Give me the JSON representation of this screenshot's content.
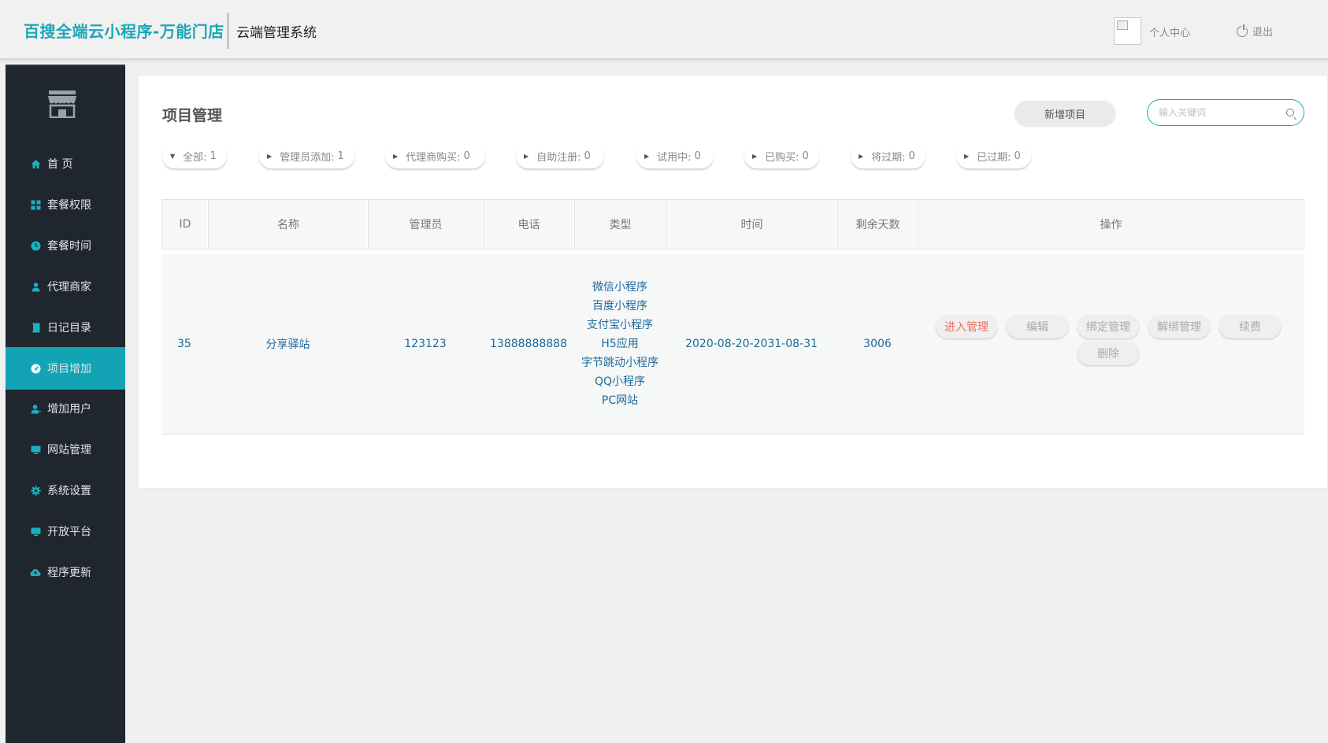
{
  "header": {
    "brand": "百搜全端云小程序-万能门店",
    "subtitle": "云端管理系统",
    "personal": "个人中心",
    "logout": "退出"
  },
  "sidebar": {
    "items": [
      {
        "label": "首 页",
        "icon": "home-icon"
      },
      {
        "label": "套餐权限",
        "icon": "grid-icon"
      },
      {
        "label": "套餐时间",
        "icon": "clock-icon"
      },
      {
        "label": "代理商家",
        "icon": "user-icon"
      },
      {
        "label": "日记目录",
        "icon": "book-icon"
      },
      {
        "label": "项目增加",
        "icon": "dashboard-icon",
        "active": true
      },
      {
        "label": "增加用户",
        "icon": "add-user-icon"
      },
      {
        "label": "网站管理",
        "icon": "monitor-icon"
      },
      {
        "label": "系统设置",
        "icon": "gear-icon"
      },
      {
        "label": "开放平台",
        "icon": "platform-icon"
      },
      {
        "label": "程序更新",
        "icon": "cloud-icon"
      }
    ]
  },
  "main": {
    "title": "项目管理",
    "new_button": "新增项目",
    "search_placeholder": "输入关键词",
    "filters": [
      {
        "label": "全部:",
        "count": "1",
        "expanded": true
      },
      {
        "label": "管理员添加:",
        "count": "1"
      },
      {
        "label": "代理商购买:",
        "count": "0"
      },
      {
        "label": "自助注册:",
        "count": "0"
      },
      {
        "label": "试用中:",
        "count": "0"
      },
      {
        "label": "已购买:",
        "count": "0"
      },
      {
        "label": "将过期:",
        "count": "0"
      },
      {
        "label": "已过期:",
        "count": "0"
      }
    ],
    "table": {
      "headers": [
        "ID",
        "名称",
        "管理员",
        "电话",
        "类型",
        "时间",
        "剩余天数",
        "操作"
      ],
      "rows": [
        {
          "id": "35",
          "name": "分享驿站",
          "admin": "123123",
          "phone": "13888888888",
          "types": [
            "微信小程序",
            "百度小程序",
            "支付宝小程序",
            "H5应用",
            "字节跳动小程序",
            "QQ小程序",
            "PC网站"
          ],
          "time": "2020-08-20-2031-08-31",
          "days": "3006",
          "actions": [
            "进入管理",
            "编辑",
            "绑定管理",
            "解绑管理",
            "续费",
            "删除"
          ]
        }
      ]
    }
  },
  "colors": {
    "brand": "#1aa7b6",
    "sidebar_bg": "#1f262e",
    "sidebar_active": "#12a4b4",
    "link_text": "#1d6a9a",
    "danger_text": "#ef6f5e"
  }
}
